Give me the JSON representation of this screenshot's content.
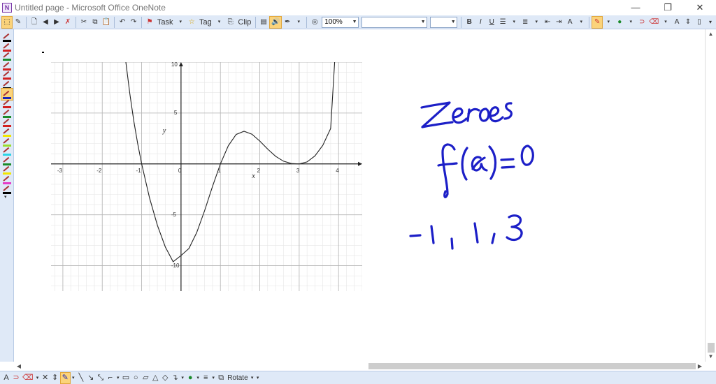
{
  "window": {
    "title": "Untitled page - Microsoft Office OneNote",
    "minimize": "—",
    "restore": "❐",
    "close": "✕"
  },
  "toolbar": {
    "task_label": "Task",
    "tag_label": "Tag",
    "clip_label": "Clip",
    "zoom_value": "100%",
    "font_value": "",
    "size_value": "",
    "bold": "B",
    "italic": "I",
    "underline": "U"
  },
  "pens": [
    {
      "color": "#000000",
      "active": false
    },
    {
      "color": "#d32020",
      "active": false
    },
    {
      "color": "#1a8a2a",
      "active": false
    },
    {
      "color": "#d32020",
      "active": false
    },
    {
      "color": "#d32020",
      "active": false
    },
    {
      "color": "#000000",
      "active": false
    },
    {
      "color": "#1b25b8",
      "active": true
    },
    {
      "color": "#d32020",
      "active": false
    },
    {
      "color": "#1a8a2a",
      "active": false
    },
    {
      "color": "#d32020",
      "active": false
    },
    {
      "color": "#f2e600",
      "active": false
    },
    {
      "color": "#9adf2a",
      "active": false
    },
    {
      "color": "#2ad3e6",
      "active": false
    },
    {
      "color": "#1a8a2a",
      "active": false
    },
    {
      "color": "#f2e600",
      "active": false
    },
    {
      "color": "#e63cc8",
      "active": false
    },
    {
      "color": "#000000",
      "active": false
    }
  ],
  "chart_data": {
    "type": "line",
    "xlabel": "x",
    "ylabel": "y",
    "xlim": [
      -3.3,
      4.6
    ],
    "ylim": [
      -12.5,
      10
    ],
    "xticks": [
      "-3",
      "-2",
      "-1",
      "0",
      "1",
      "2",
      "3",
      "4"
    ],
    "yticks": [
      "10",
      "5",
      "-5",
      "-10"
    ],
    "grid": true,
    "series": [
      {
        "x": [
          -1.4,
          -1.3,
          -1.2,
          -1.1,
          -1.0,
          -0.8,
          -0.6,
          -0.4,
          -0.2,
          0.0,
          0.2,
          0.4,
          0.6,
          0.8,
          1.0,
          1.2,
          1.4,
          1.6,
          1.8,
          2.0,
          2.2,
          2.4,
          2.6,
          2.8,
          3.0,
          3.2,
          3.4,
          3.6,
          3.8,
          3.9
        ],
        "y": [
          10.0,
          6.89,
          4.24,
          2.0,
          0.0,
          -3.32,
          -6.03,
          -8.15,
          -9.61,
          -9.0,
          -8.31,
          -6.73,
          -4.58,
          -2.22,
          0.0,
          1.78,
          2.89,
          3.21,
          2.92,
          2.25,
          1.46,
          0.75,
          0.27,
          0.04,
          0.0,
          0.2,
          0.79,
          1.83,
          3.48,
          10.0
        ]
      }
    ],
    "xlabel_pos": "below-axis",
    "ylabel_pos": "left-of-axis"
  },
  "ink": {
    "color": "#1c1fc7",
    "heading": "Zeroes",
    "equation": "f(x) = 0",
    "answer": "-1, 1, 3"
  },
  "drawbar": {
    "rotate_label": "Rotate"
  },
  "icons": {
    "app": "onenote-icon",
    "new": "new-page-icon",
    "back": "back-icon",
    "forward": "forward-icon",
    "cut": "cut-icon",
    "copy": "copy-icon",
    "paste": "paste-icon",
    "undo": "undo-icon",
    "redo": "redo-icon"
  }
}
